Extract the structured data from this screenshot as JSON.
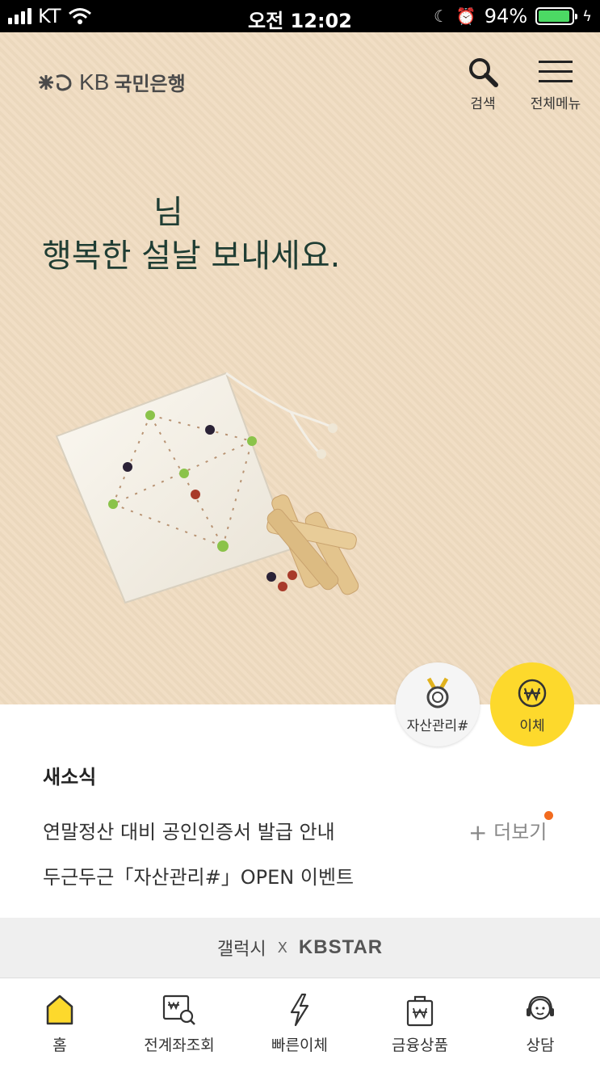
{
  "status_bar": {
    "carrier": "KT",
    "time": "오전 12:02",
    "battery": "94%",
    "battery_level": 0.94
  },
  "header": {
    "brand_kb": "KB",
    "brand_name": "국민은행",
    "search_label": "검색",
    "menu_label": "전체메뉴"
  },
  "hero": {
    "greeting_name": "님",
    "greeting": "행복한 설날 보내세요."
  },
  "floating": {
    "asset_label": "자산관리#",
    "transfer_label": "이체"
  },
  "news": {
    "title": "새소식",
    "items": [
      "연말정산 대비 공인인증서 발급 안내",
      "두근두근「자산관리#」OPEN 이벤트"
    ],
    "more_label": "더보기"
  },
  "banner": {
    "left": "갤럭시",
    "sep": "X",
    "right": "KBSTAR"
  },
  "tabs": [
    {
      "label": "홈",
      "icon": "home-icon"
    },
    {
      "label": "전계좌조회",
      "icon": "account-search-icon"
    },
    {
      "label": "빠른이체",
      "icon": "lightning-icon"
    },
    {
      "label": "금융상품",
      "icon": "shopping-bag-icon"
    },
    {
      "label": "상담",
      "icon": "headset-icon"
    }
  ],
  "colors": {
    "hero_bg": "#f0dcc1",
    "hero_text": "#1f3d33",
    "accent_yellow": "#fdd92c",
    "badge_orange": "#f26b1f",
    "battery_green": "#4cd964"
  }
}
